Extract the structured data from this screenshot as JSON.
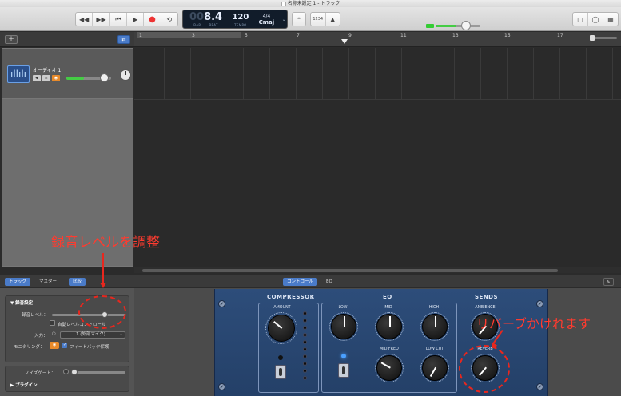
{
  "window": {
    "title": "名称未設定 1 - トラック"
  },
  "transport": {
    "buttons": [
      "rewind",
      "fast-forward",
      "to-start",
      "play",
      "record",
      "cycle"
    ],
    "lcd": {
      "position_dim": "00",
      "position": "8.4",
      "bar_label": "BAR",
      "beat_label": "BEAT",
      "tempo": "120",
      "tempo_label": "TEMPO",
      "time_sig": "4/4",
      "key": "Cmaj"
    },
    "count_in": "1234"
  },
  "ruler": {
    "bars": [
      "1",
      "3",
      "5",
      "7",
      "9",
      "11",
      "13",
      "15",
      "17"
    ]
  },
  "track": {
    "name": "オーディオ 1"
  },
  "bottom_tabs": {
    "track": "トラック",
    "master": "マスター",
    "compare": "比較",
    "controls": "コントロール",
    "eq": "EQ"
  },
  "inspector": {
    "section_title": "▼ 録音設定",
    "rec_level_label": "録音レベル：",
    "auto_level_label": "自動レベルコントロール",
    "input_label": "入力：",
    "input_value": "1 (外部マイク)",
    "monitoring_label": "モニタリング：",
    "feedback_label": "フィードバック保護",
    "noise_gate_label": "ノイズゲート：",
    "plugins_label": "▶ プラグイン"
  },
  "plugin": {
    "compressor": {
      "title": "COMPRESSOR",
      "amount": "AMOUNT",
      "amount_value": 0.35
    },
    "eq": {
      "title": "EQ",
      "low": "LOW",
      "mid": "MID",
      "high": "HIGH",
      "mid_freq": "MID FREQ",
      "low_cut": "LOW CUT"
    },
    "sends": {
      "title": "SENDS",
      "ambience": "AMBIENCE",
      "reverb": "REVERB"
    }
  },
  "annotations": {
    "rec_level": "録音レベルを調整",
    "reverb": "リバーブかけれます"
  },
  "colors": {
    "accent": "#4a7bc8",
    "annotation": "#e8271e",
    "plugin_bg": "#2d4d7a"
  }
}
